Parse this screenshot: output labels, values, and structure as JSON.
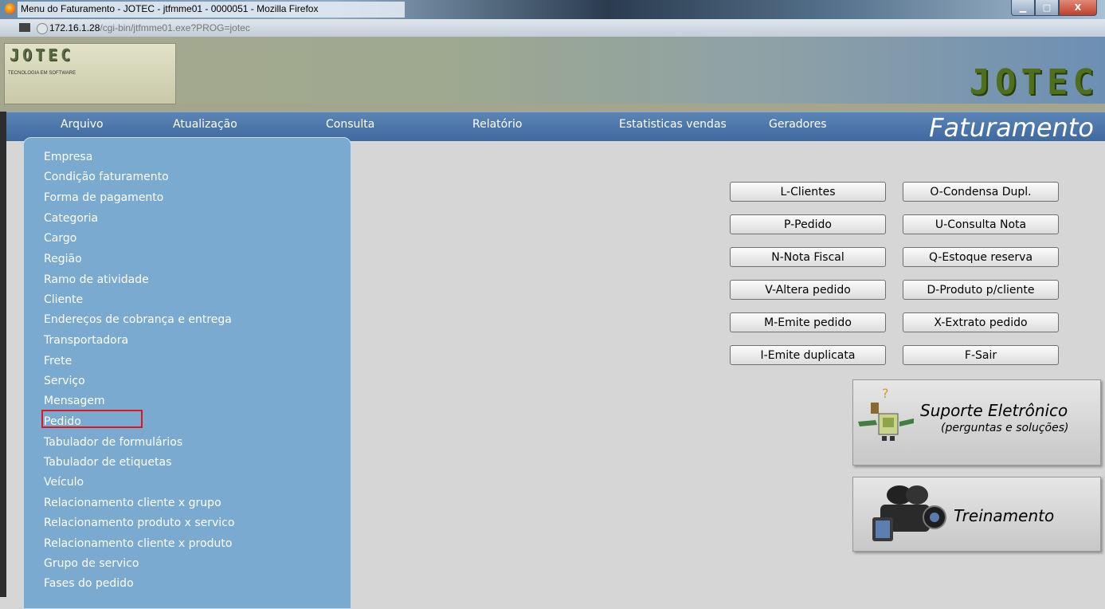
{
  "browser": {
    "window_title": "Menu do Faturamento - JOTEC - jtfmme01 - 0000051 - Mozilla Firefox",
    "url_host": "172.16.1.28",
    "url_path": "/cgi-bin/jtfmme01.exe?PROG=jotec",
    "min_glyph": "▁",
    "max_glyph": "□",
    "close_glyph": "X"
  },
  "header": {
    "logo_small": "JOTEC",
    "logo_tagline": "TECNOLOGIA EM SOFTWARE",
    "logo_big": "JOTEC"
  },
  "menubar": {
    "items": [
      {
        "label": "Arquivo"
      },
      {
        "label": "Atualização"
      },
      {
        "label": "Consulta"
      },
      {
        "label": "Relatório"
      },
      {
        "label": "Estatisticas vendas"
      },
      {
        "label": "Geradores"
      }
    ],
    "module_title": "Faturamento"
  },
  "dropdown": {
    "items": [
      {
        "label": "Empresa"
      },
      {
        "label": "Condição faturamento"
      },
      {
        "label": "Forma de pagamento"
      },
      {
        "label": "Categoria"
      },
      {
        "label": "Cargo"
      },
      {
        "label": "Região"
      },
      {
        "label": "Ramo de atividade"
      },
      {
        "label": "Cliente"
      },
      {
        "label": "Endereços de cobrança e entrega"
      },
      {
        "label": "Transportadora"
      },
      {
        "label": "Frete"
      },
      {
        "label": "Serviço"
      },
      {
        "label": "Mensagem"
      },
      {
        "label": "Pedido"
      },
      {
        "label": "Tabulador de formulários"
      },
      {
        "label": "Tabulador de etiquetas"
      },
      {
        "label": "Veículo"
      },
      {
        "label": "Relacionamento cliente x grupo"
      },
      {
        "label": "Relacionamento produto x servico"
      },
      {
        "label": "Relacionamento cliente x produto"
      },
      {
        "label": "Grupo de servico"
      },
      {
        "label": "Fases do pedido"
      }
    ],
    "highlighted": "Pedido",
    "highlight_color": "#e0161d"
  },
  "shortcuts": {
    "left": [
      {
        "label": "L-Clientes"
      },
      {
        "label": "P-Pedido"
      },
      {
        "label": "N-Nota Fiscal"
      },
      {
        "label": "V-Altera pedido"
      },
      {
        "label": "M-Emite pedido"
      },
      {
        "label": "I-Emite duplicata"
      }
    ],
    "right": [
      {
        "label": "O-Condensa Dupl."
      },
      {
        "label": "U-Consulta Nota"
      },
      {
        "label": "Q-Estoque reserva"
      },
      {
        "label": "D-Produto p/cliente"
      },
      {
        "label": "X-Extrato pedido"
      },
      {
        "label": "F-Sair"
      }
    ]
  },
  "support": {
    "title": "Suporte Eletrônico",
    "subtitle": "(perguntas e soluções)",
    "icon": "robot-icon"
  },
  "training": {
    "title": "Treinamento",
    "icon": "video-camera-icon"
  },
  "colors": {
    "menubar": "#4a74a8",
    "dropdown": "#7aaad0",
    "background": "#d6d6d6"
  }
}
